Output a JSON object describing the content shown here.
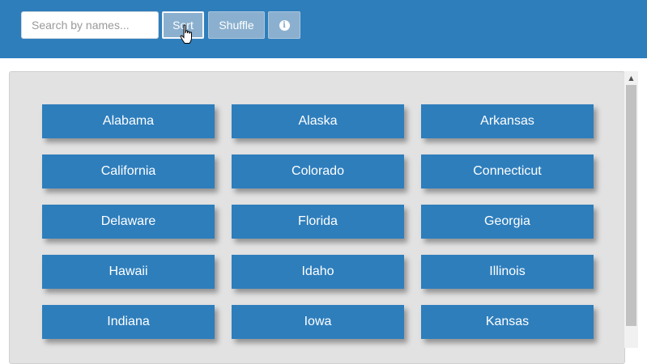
{
  "toolbar": {
    "search_placeholder": "Search by names...",
    "search_value": "",
    "sort_label": "Sort",
    "shuffle_label": "Shuffle",
    "info_icon": "info-circle-icon",
    "info_glyph": "i"
  },
  "colors": {
    "header_bg": "#2e7ebc",
    "button_bg": "#2e7ebc",
    "toolbar_button_bg": "#8bb0cf",
    "panel_bg": "#e2e2e2"
  },
  "states": [
    {
      "label": "Alabama"
    },
    {
      "label": "Alaska"
    },
    {
      "label": "Arkansas"
    },
    {
      "label": "California"
    },
    {
      "label": "Colorado"
    },
    {
      "label": "Connecticut"
    },
    {
      "label": "Delaware"
    },
    {
      "label": "Florida"
    },
    {
      "label": "Georgia"
    },
    {
      "label": "Hawaii"
    },
    {
      "label": "Idaho"
    },
    {
      "label": "Illinois"
    },
    {
      "label": "Indiana"
    },
    {
      "label": "Iowa"
    },
    {
      "label": "Kansas"
    }
  ],
  "scrollbar": {
    "up_glyph": "▲"
  }
}
